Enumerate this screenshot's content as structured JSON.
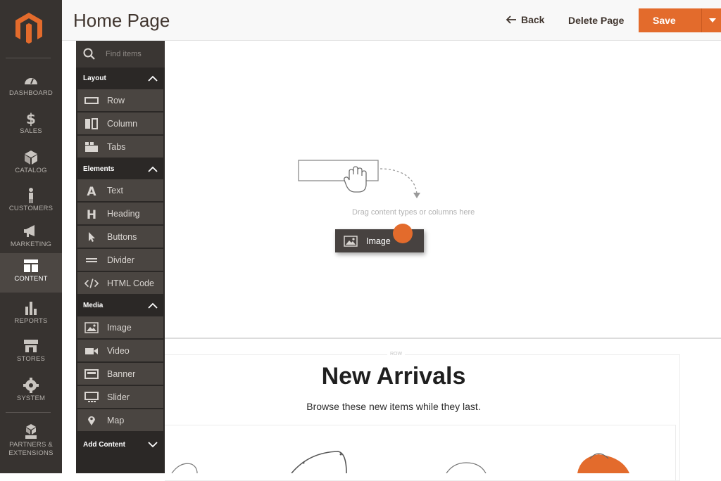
{
  "header": {
    "title": "Home Page",
    "back_label": "Back",
    "delete_label": "Delete Page",
    "save_label": "Save"
  },
  "nav": [
    {
      "label": "DASHBOARD",
      "icon": "dashboard-icon"
    },
    {
      "label": "SALES",
      "icon": "dollar-icon"
    },
    {
      "label": "CATALOG",
      "icon": "cube-icon"
    },
    {
      "label": "CUSTOMERS",
      "icon": "person-icon"
    },
    {
      "label": "MARKETING",
      "icon": "megaphone-icon"
    },
    {
      "label": "CONTENT",
      "icon": "layout-icon",
      "active": true
    },
    {
      "label": "REPORTS",
      "icon": "bar-chart-icon"
    },
    {
      "label": "STORES",
      "icon": "store-icon"
    },
    {
      "label": "SYSTEM",
      "icon": "gear-icon"
    },
    {
      "label": "PARTNERS &",
      "label2": "EXTENSIONS",
      "icon": "boxes-icon"
    }
  ],
  "panel": {
    "search_placeholder": "Find items",
    "groups": {
      "layout": "Layout",
      "elements": "Elements",
      "media": "Media",
      "add_content": "Add Content"
    },
    "layout_items": [
      "Row",
      "Column",
      "Tabs"
    ],
    "element_items": [
      "Text",
      "Heading",
      "Buttons",
      "Divider",
      "HTML Code"
    ],
    "media_items": [
      "Image",
      "Video",
      "Banner",
      "Slider",
      "Map"
    ]
  },
  "stage": {
    "drop_hint": "Drag content types or columns here",
    "dragging_label": "Image"
  },
  "row": {
    "label": "ROW",
    "title": "New Arrivals",
    "subtitle": "Browse these new items while they last."
  },
  "colors": {
    "accent": "#e36b2c",
    "nav_bg": "#373330",
    "panel_bg": "#2b2826",
    "panel_item": "#4a4541"
  }
}
